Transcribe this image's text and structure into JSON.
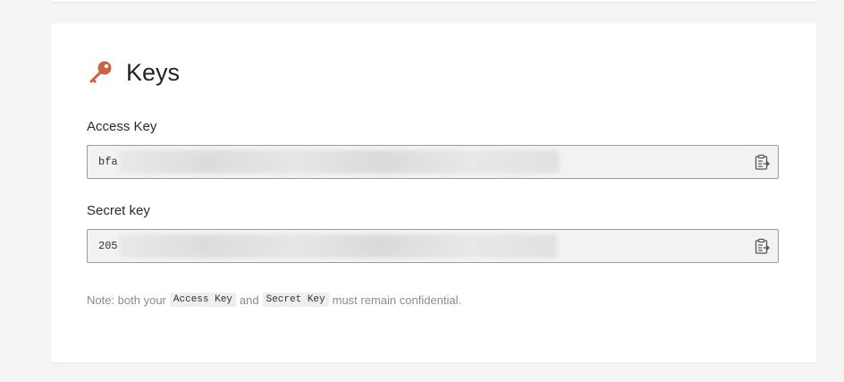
{
  "keys_section": {
    "title": "Keys",
    "access_key": {
      "label": "Access Key",
      "value": "bfa"
    },
    "secret_key": {
      "label": "Secret key",
      "value": "205"
    },
    "note": {
      "prefix": "Note: both your",
      "code1": "Access Key",
      "middle": "and",
      "code2": "Secret Key",
      "suffix": "must remain confidential."
    }
  },
  "colors": {
    "key_icon": "#c8623f",
    "background": "#f5f5f5",
    "card": "#ffffff"
  },
  "icons": {
    "title": "key-icon",
    "copy": "clipboard-icon"
  }
}
